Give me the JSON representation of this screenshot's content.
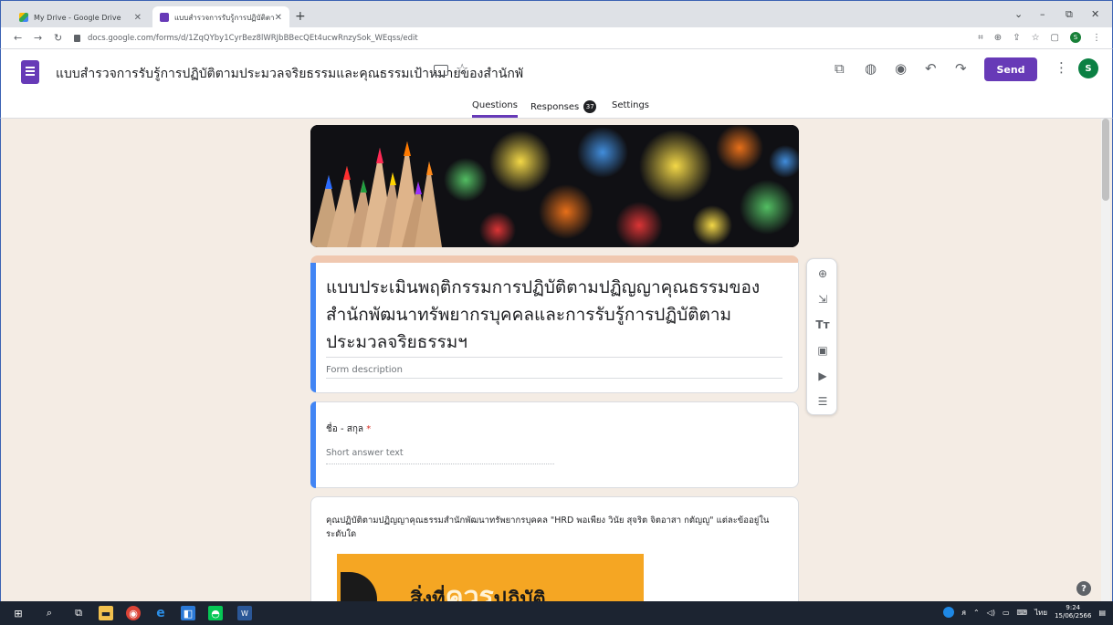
{
  "browser": {
    "tabs": [
      {
        "title": "My Drive - Google Drive",
        "active": false
      },
      {
        "title": "แบบสำรวจการรับรู้การปฏิบัติตามประ...",
        "active": true
      }
    ],
    "url": "docs.google.com/forms/d/1ZqQYby1CyrBez8lWRJbBBecQEt4ucwRnzySok_WEqss/edit",
    "profile_initial": "S"
  },
  "header": {
    "doc_title": "แบบสำรวจการรับรู้การปฏิบัติตามประมวลจริยธรรมและคุณธรรมเป้าหมายของสำนักพั",
    "send_label": "Send",
    "avatar_initial": "S",
    "tabs": {
      "questions": "Questions",
      "responses": "Responses",
      "responses_count": "37",
      "settings": "Settings"
    }
  },
  "form": {
    "title": "แบบประเมินพฤติกรรมการปฏิบัติตามปฏิญญาคุณธรรมของสำนักพัฒนาทรัพยากรบุคคลและการรับรู้การปฏิบัติตามประมวลจริยธรรมฯ",
    "description_placeholder": "Form description",
    "questions": [
      {
        "label": "ชื่อ - สกุล",
        "required": true,
        "placeholder": "Short answer text"
      },
      {
        "label": "คุณปฏิบัติตามปฏิญญาคุณธรรมสำนักพัฒนาทรัพยากรบุคคล \"HRD  พอเพียง วินัย สุจริต จิตอาสา กตัญญู\" แต่ละข้ออยู่ในระดับใด",
        "image_text_1": "สิ่งที่",
        "image_text_2": "ควร",
        "image_text_3": "ปฏิบัติ"
      }
    ]
  },
  "taskbar": {
    "time": "9:24",
    "date": "15/06/2566",
    "lang": "ไทย"
  },
  "colors": {
    "accent": "#673ab7",
    "page_bg": "#f4ece4",
    "question_bar": "#4285f4"
  }
}
